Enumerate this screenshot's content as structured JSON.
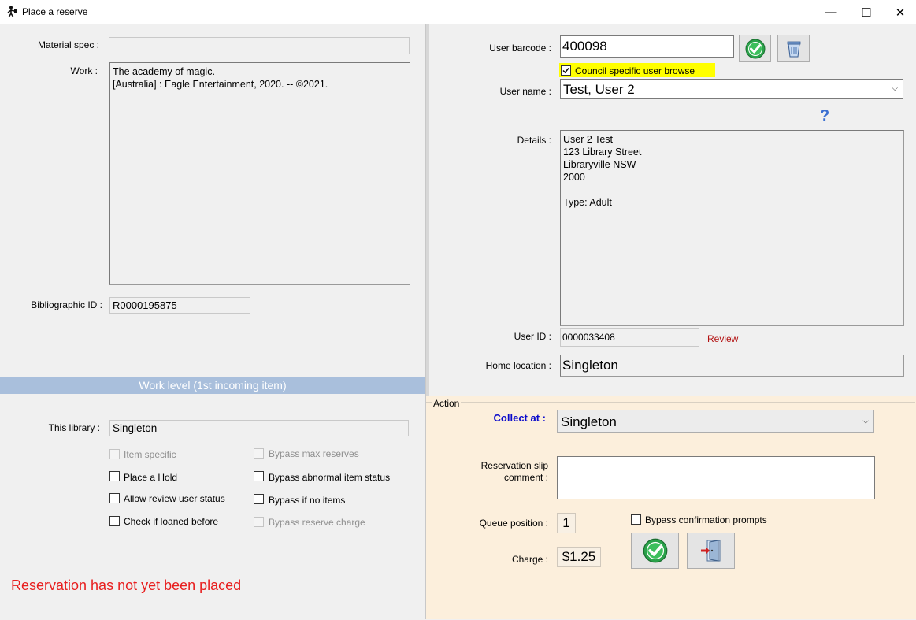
{
  "window": {
    "title": "Place a reserve",
    "minimize_glyph": "—",
    "maximize_glyph": "☐",
    "close_glyph": "✕"
  },
  "left": {
    "material_spec_label": "Material spec :",
    "material_spec_value": "",
    "work_label": "Work :",
    "work_text": "The academy of magic.\n[Australia] : Eagle Entertainment, 2020. -- ©2021.",
    "bib_id_label": "Bibliographic ID :",
    "bib_id_value": "R0000195875",
    "banner": "Work level (1st incoming item)",
    "this_library_label": "This library :",
    "this_library_value": "Singleton",
    "checkboxes": [
      {
        "label": "Item specific",
        "checked": false,
        "enabled": false
      },
      {
        "label": "Bypass max reserves",
        "checked": false,
        "enabled": false
      },
      {
        "label": "Place a Hold",
        "checked": false,
        "enabled": true
      },
      {
        "label": "Bypass abnormal item status",
        "checked": false,
        "enabled": true
      },
      {
        "label": "Allow review user status",
        "checked": false,
        "enabled": true
      },
      {
        "label": "Bypass if no items",
        "checked": false,
        "enabled": true
      },
      {
        "label": "Check if loaned before",
        "checked": false,
        "enabled": true
      },
      {
        "label": "Bypass reserve charge",
        "checked": false,
        "enabled": false
      }
    ],
    "status_message": "Reservation has not yet been placed"
  },
  "user": {
    "barcode_label": "User barcode :",
    "barcode_value": "400098",
    "council_browse_label": "Council specific user browse",
    "council_browse_checked": true,
    "user_name_label": "User name :",
    "user_name_value": "Test, User 2",
    "help_glyph": "?",
    "details_label": "Details :",
    "details_text": "User 2 Test\n123 Library Street\nLibraryville NSW\n2000\n\nType:    Adult",
    "user_id_label": "User ID :",
    "user_id_value": "0000033408",
    "review_link": "Review",
    "home_location_label": "Home location :",
    "home_location_value": "Singleton"
  },
  "action": {
    "legend": "Action",
    "collect_at_label": "Collect at :",
    "collect_at_value": "Singleton",
    "slip_comment_label": "Reservation slip\ncomment :",
    "slip_comment_value": "",
    "queue_position_label": "Queue position :",
    "queue_position_value": "1",
    "charge_label": "Charge :",
    "charge_value": "$1.25",
    "bypass_confirmation_label": "Bypass confirmation prompts",
    "bypass_confirmation_checked": false
  },
  "colors": {
    "banner": "#a9bfdc",
    "action_bg": "#fcefdc",
    "status_red": "#e81e1e",
    "collect_blue": "#0a0acb",
    "highlight_yellow": "#ffff00"
  }
}
